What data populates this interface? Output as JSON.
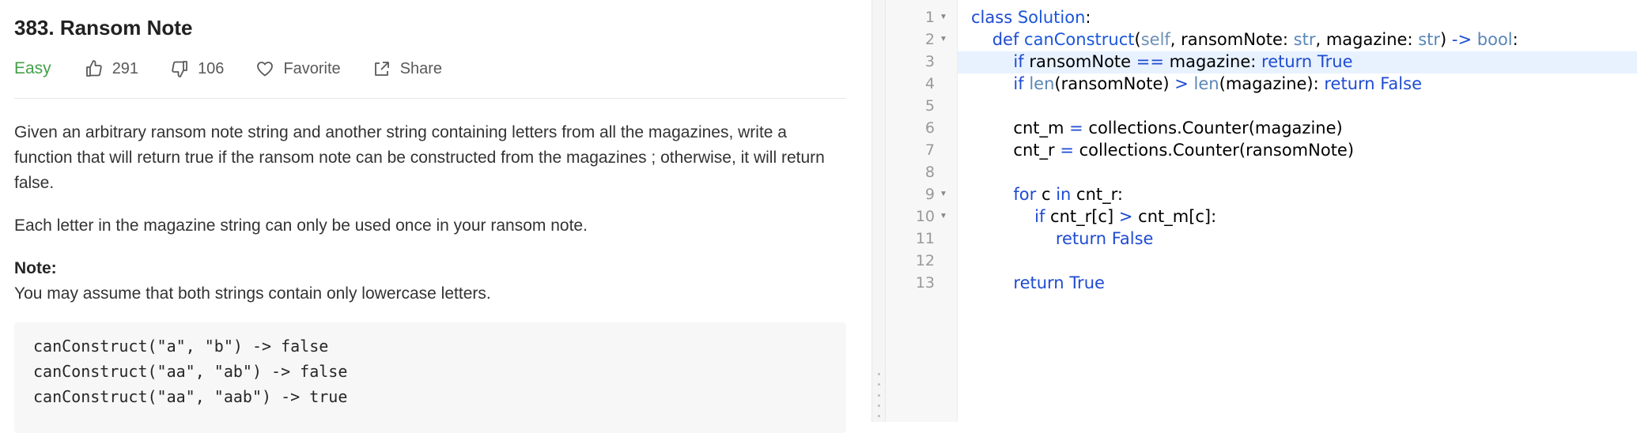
{
  "problem": {
    "title": "383. Ransom Note",
    "difficulty": "Easy",
    "likes": "291",
    "dislikes": "106",
    "favorite_label": "Favorite",
    "share_label": "Share",
    "description_p1": "Given an arbitrary ransom note string and another string containing letters from all the magazines, write a function that will return true if the ransom note can be constructed from the magazines ; otherwise, it will return false.",
    "description_p2": "Each letter in the magazine string can only be used once in your ransom note.",
    "note_label": "Note:",
    "note_text": "You may assume that both strings contain only lowercase letters.",
    "examples": [
      "canConstruct(\"a\", \"b\") -> false",
      "canConstruct(\"aa\", \"ab\") -> false",
      "canConstruct(\"aa\", \"aab\") -> true"
    ]
  },
  "editor": {
    "line_numbers": [
      "1",
      "2",
      "3",
      "4",
      "5",
      "6",
      "7",
      "8",
      "9",
      "10",
      "11",
      "12",
      "13"
    ],
    "fold_marker": "▼",
    "highlighted_line": 3,
    "code": {
      "l1": [
        "class",
        " ",
        "Solution",
        ":"
      ],
      "l2": [
        "    ",
        "def",
        " ",
        "canConstruct",
        "(",
        "self",
        ", ransomNote: ",
        "str",
        ", magazine: ",
        "str",
        ") ",
        "->",
        " ",
        "bool",
        ":"
      ],
      "l3": [
        "        ",
        "if",
        " ransomNote ",
        "==",
        " magazine: ",
        "return",
        " ",
        "True"
      ],
      "l4": [
        "        ",
        "if",
        " ",
        "len",
        "(ransomNote) ",
        ">",
        " ",
        "len",
        "(magazine): ",
        "return",
        " ",
        "False"
      ],
      "l6": [
        "        cnt_m ",
        "=",
        " collections.Counter(magazine)"
      ],
      "l7": [
        "        cnt_r ",
        "=",
        " collections.Counter(ransomNote)"
      ],
      "l9": [
        "        ",
        "for",
        " c ",
        "in",
        " cnt_r:"
      ],
      "l10": [
        "            ",
        "if",
        " cnt_r[c] ",
        ">",
        " cnt_m[c]:"
      ],
      "l11": [
        "                ",
        "return",
        " ",
        "False"
      ],
      "l13": [
        "        ",
        "return",
        " ",
        "True"
      ]
    }
  },
  "colors": {
    "difficulty_easy": "#43a047",
    "keyword": "#1e4bd2",
    "builtin": "#5a86b8",
    "highlight": "#e8f2ff"
  }
}
